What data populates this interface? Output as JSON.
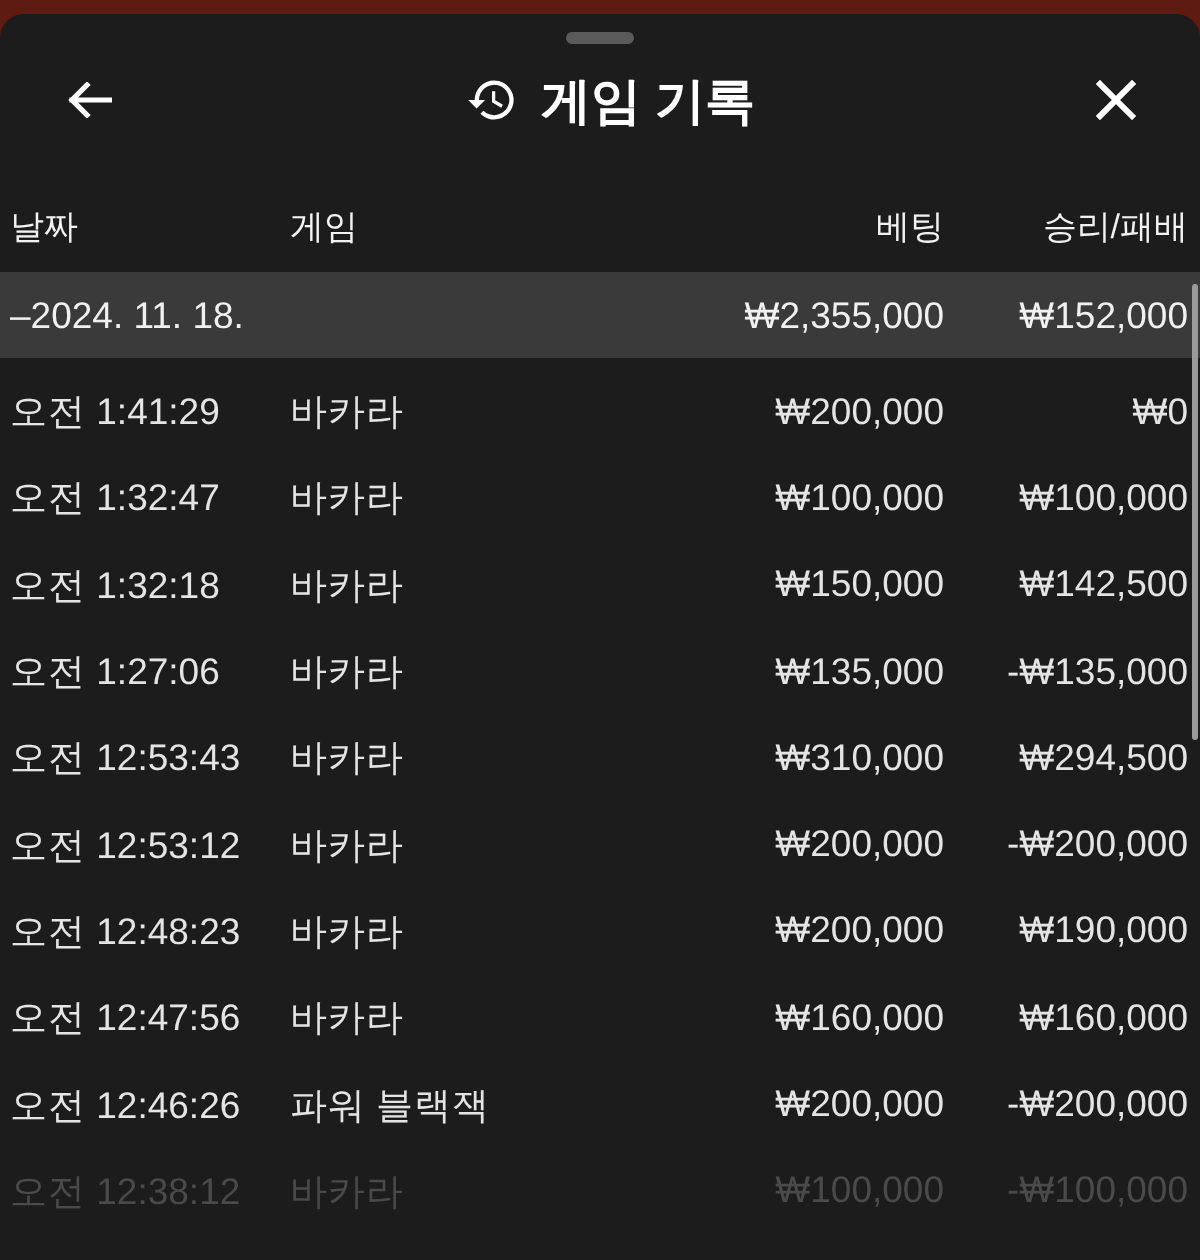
{
  "header": {
    "title": "게임 기록"
  },
  "table": {
    "columns": [
      "날짜",
      "게임",
      "베팅",
      "승리/패배"
    ],
    "summary": {
      "date": "–2024. 11. 18.",
      "bet": "₩2,355,000",
      "result": "₩152,000"
    },
    "rows": [
      {
        "time": "오전 1:41:29",
        "game": "바카라",
        "bet": "₩200,000",
        "result": "₩0",
        "faded": false
      },
      {
        "time": "오전 1:32:47",
        "game": "바카라",
        "bet": "₩100,000",
        "result": "₩100,000",
        "faded": false
      },
      {
        "time": "오전 1:32:18",
        "game": "바카라",
        "bet": "₩150,000",
        "result": "₩142,500",
        "faded": false
      },
      {
        "time": "오전 1:27:06",
        "game": "바카라",
        "bet": "₩135,000",
        "result": "-₩135,000",
        "faded": false
      },
      {
        "time": "오전 12:53:43",
        "game": "바카라",
        "bet": "₩310,000",
        "result": "₩294,500",
        "faded": false
      },
      {
        "time": "오전 12:53:12",
        "game": "바카라",
        "bet": "₩200,000",
        "result": "-₩200,000",
        "faded": false
      },
      {
        "time": "오전 12:48:23",
        "game": "바카라",
        "bet": "₩200,000",
        "result": "₩190,000",
        "faded": false
      },
      {
        "time": "오전 12:47:56",
        "game": "바카라",
        "bet": "₩160,000",
        "result": "₩160,000",
        "faded": false
      },
      {
        "time": "오전 12:46:26",
        "game": "파워 블랙잭",
        "bet": "₩200,000",
        "result": "-₩200,000",
        "faded": false
      },
      {
        "time": "오전 12:38:12",
        "game": "바카라",
        "bet": "₩100,000",
        "result": "-₩100,000",
        "faded": true
      }
    ]
  }
}
